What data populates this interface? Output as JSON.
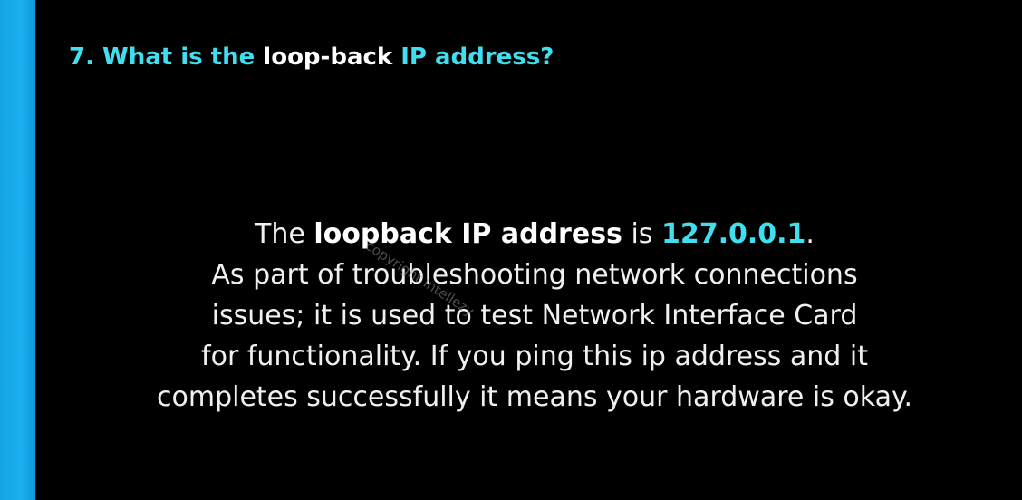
{
  "slide": {
    "title": {
      "prefix": "7. What is the ",
      "highlight": "loop-back",
      "suffix": " IP address?"
    },
    "answer": {
      "line1": {
        "pre": "The ",
        "bold": "loopback IP address",
        "mid": " is ",
        "ip": "127.0.0.1",
        "post": "."
      },
      "line2": "As part of troubleshooting network connections",
      "line3": "issues; it is used to test Network Interface Card",
      "line4": "for functionality. If you ping this ip address and it",
      "line5": "completes successfully it means your hardware is okay."
    },
    "watermark": "copyright Intellezy",
    "colors": {
      "background": "#000000",
      "sidebar": "#1ab0f0",
      "accent": "#40dff0",
      "text": "#f0f0f0"
    }
  }
}
